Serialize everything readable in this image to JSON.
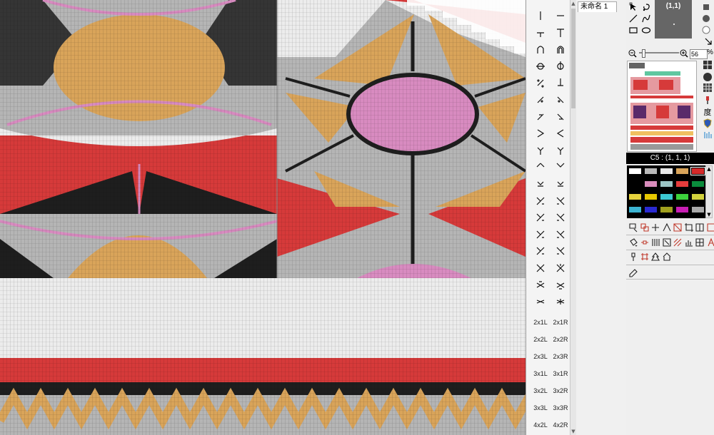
{
  "document_tab": {
    "label": "未命名 1"
  },
  "coord_display": {
    "value": "(1,1)"
  },
  "zoom": {
    "value": "56",
    "unit": "%"
  },
  "color_header": {
    "label": "C5 : (1, 1, 1)"
  },
  "palette": {
    "text_rows": [
      [
        "2x1L",
        "2x1R"
      ],
      [
        "2x2L",
        "2x2R"
      ],
      [
        "2x3L",
        "2x3R"
      ],
      [
        "3x1L",
        "3x1R"
      ],
      [
        "3x2L",
        "3x2R"
      ],
      [
        "3x3L",
        "3x3R"
      ],
      [
        "4x2L",
        "4x2R"
      ]
    ]
  },
  "swatches": [
    "#ffffff",
    "#b9b9b9",
    "#e8e8e8",
    "#d9a45a",
    "#d52a2a",
    "#000000",
    "#d98cbc",
    "#9cc4c4",
    "#e63c3c",
    "#0a8c3c",
    "#e6d23c",
    "#e6c800",
    "#3cc8d2",
    "#3cd23c",
    "#d2d23c",
    "#3cb4d2",
    "#2a2ad2",
    "#a0a01e",
    "#c81eb4",
    "#aaaaaa"
  ],
  "colors": {
    "red": "#d63a3a",
    "tan": "#d9a45a",
    "pink": "#d88bc0",
    "gray": "#b5b5b5",
    "light": "#ececec",
    "black": "#1e1e1e"
  },
  "icons": [
    "line-icon",
    "curve-icon",
    "rectangle-icon",
    "ellipse-icon",
    "fill-icon",
    "select-icon",
    "move-icon",
    "eyedropper-icon"
  ]
}
